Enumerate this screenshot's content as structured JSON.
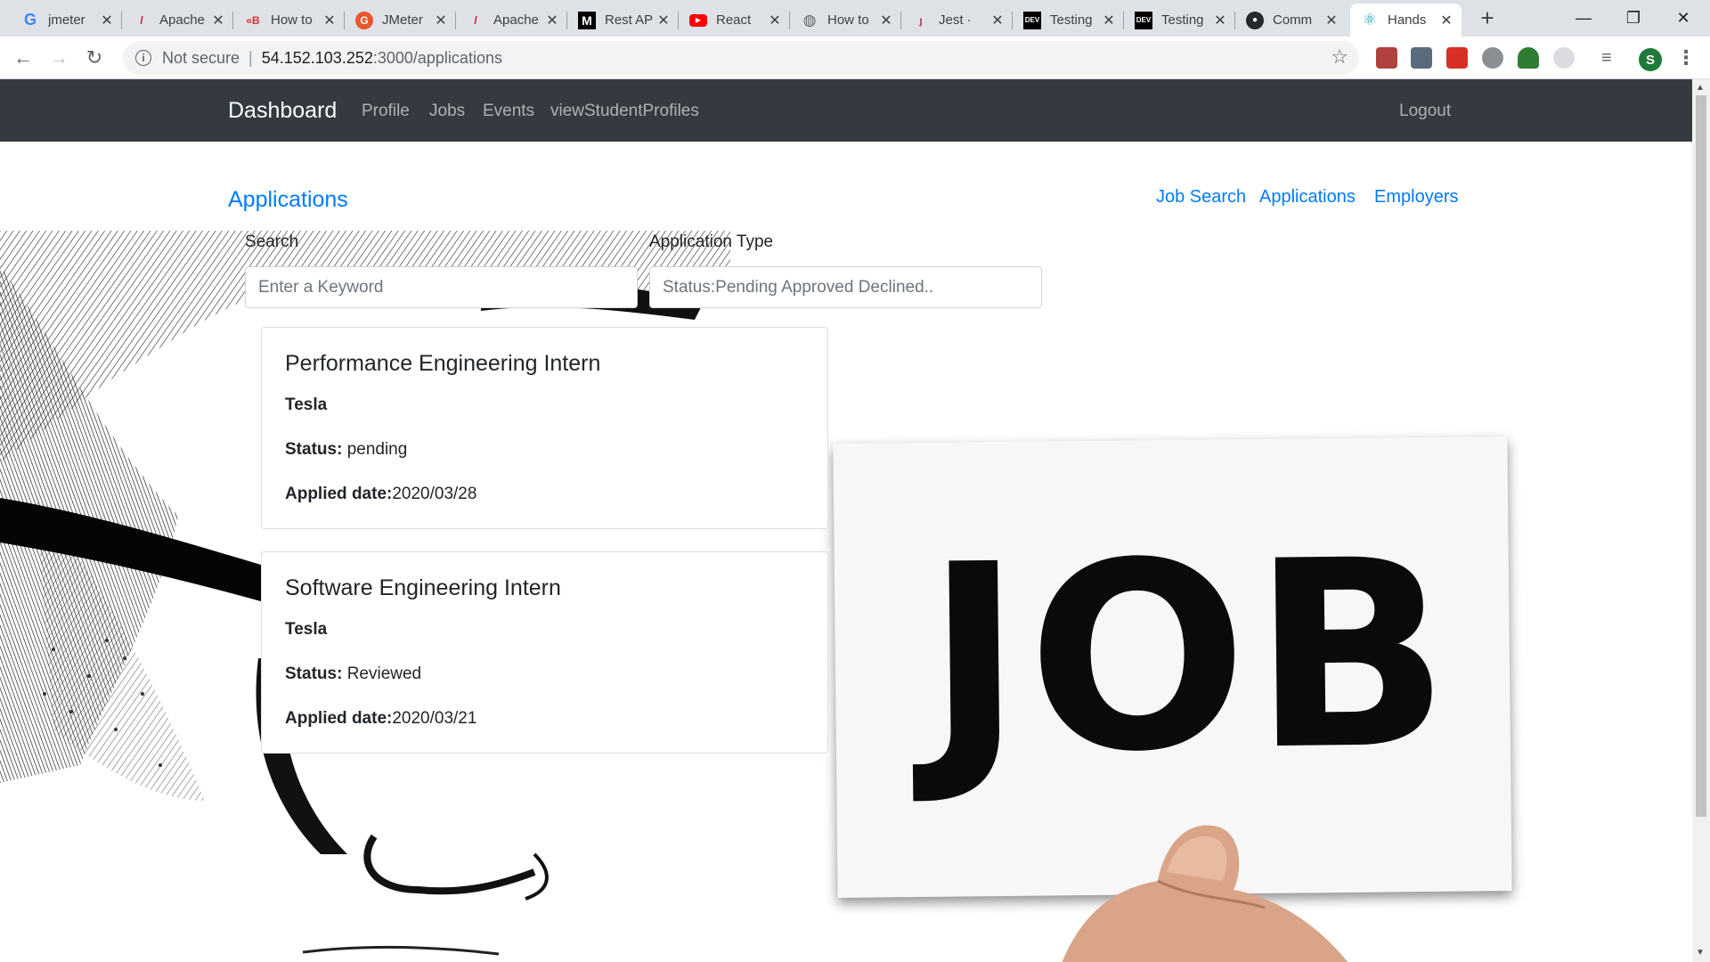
{
  "browser": {
    "tabs": [
      {
        "title": "jmeter",
        "icon": "google-icon"
      },
      {
        "title": "Apache",
        "icon": "apache-feather-icon"
      },
      {
        "title": "How to",
        "icon": "blazemeter-icon"
      },
      {
        "title": "JMeter",
        "icon": "jmeter-icon"
      },
      {
        "title": "Apache",
        "icon": "apache-feather-icon"
      },
      {
        "title": "Rest AP",
        "icon": "medium-icon"
      },
      {
        "title": "React",
        "icon": "youtube-icon"
      },
      {
        "title": "How to",
        "icon": "globe-icon"
      },
      {
        "title": "Jest ·",
        "icon": "jest-icon"
      },
      {
        "title": "Testing",
        "icon": "dev-icon"
      },
      {
        "title": "Testing",
        "icon": "dev-icon"
      },
      {
        "title": "Comm",
        "icon": "github-icon"
      },
      {
        "title": "Hands",
        "icon": "react-icon"
      }
    ],
    "address": {
      "security": "Not secure",
      "host": "54.152.103.252",
      "path": ":3000/applications"
    },
    "profile_initial": "S"
  },
  "navbar": {
    "brand": "Dashboard",
    "links": [
      "Profile",
      "Jobs",
      "Events",
      "viewStudentProfiles"
    ],
    "logout": "Logout"
  },
  "page": {
    "title": "Applications",
    "sublinks": [
      "Job Search",
      "Applications",
      "Employers"
    ],
    "search": {
      "label": "Search",
      "placeholder": "Enter a Keyword"
    },
    "type": {
      "label": "Application Type",
      "placeholder": "Status:Pending Approved Declined.."
    },
    "background_text": "JOB"
  },
  "applications": [
    {
      "title": "Performance Engineering Intern",
      "company": "Tesla",
      "status_label": "Status:",
      "status": "pending",
      "date_label": "Applied date:",
      "date": "2020/03/28"
    },
    {
      "title": "Software Engineering Intern",
      "company": "Tesla",
      "status_label": "Status:",
      "status": "Reviewed",
      "date_label": "Applied date:",
      "date": "2020/03/21"
    }
  ],
  "colors": {
    "navbar": "#343a40",
    "link": "#007bff"
  }
}
